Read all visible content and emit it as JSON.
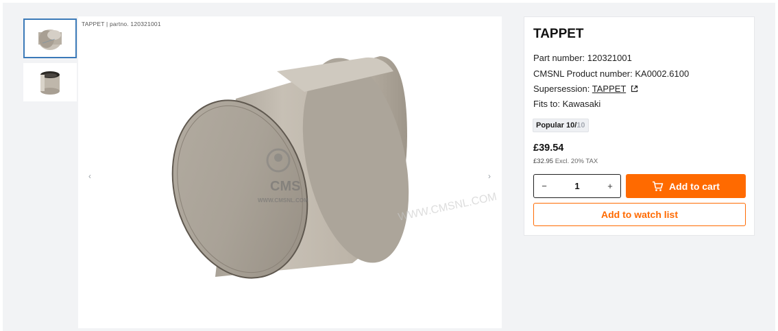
{
  "gallery": {
    "caption": "TAPPET | partno. 120321001",
    "prev_arrow": "‹",
    "next_arrow": "›",
    "watermark_logo": "CMS",
    "watermark_site": "WWW.CMSNL.COM",
    "watermark_repeat": "WWW.CMSNL.COM"
  },
  "product": {
    "title": "TAPPET",
    "part_number_label": "Part number:",
    "part_number": "120321001",
    "cmsnl_label": "CMSNL Product number:",
    "cmsnl_number": "KA0002.6100",
    "supersession_label": "Supersession:",
    "supersession_link": "TAPPET",
    "fits_label": "Fits to:",
    "fits_value": "Kawasaki",
    "popular_label": "Popular 10/",
    "popular_max": "10",
    "price": "£39.54",
    "price_excl": "£32.95",
    "tax_note": "Excl. 20% TAX",
    "quantity": "1",
    "minus": "−",
    "plus": "+",
    "add_to_cart": "Add to cart",
    "add_to_watch": "Add to watch list"
  },
  "colors": {
    "accent": "#ff6a00",
    "thumb_selected_border": "#3a79b8",
    "page_bg": "#f2f3f5"
  },
  "icons": {
    "cart": "cart-icon",
    "external": "external-link-icon",
    "prev": "chevron-left-icon",
    "next": "chevron-right-icon"
  }
}
